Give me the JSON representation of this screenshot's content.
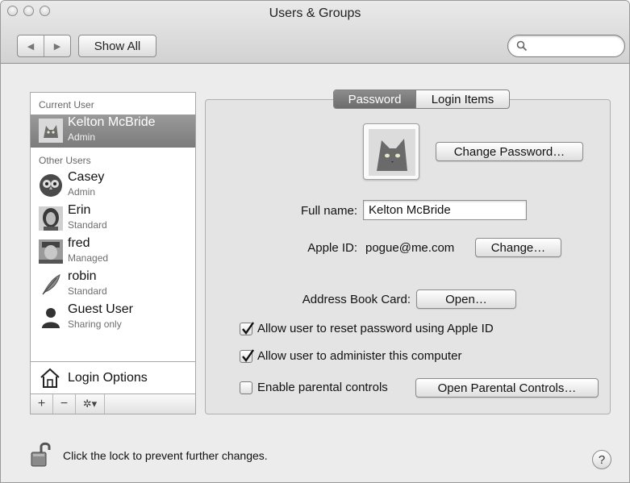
{
  "window": {
    "title": "Users & Groups"
  },
  "toolbar": {
    "back_icon": "◀",
    "forward_icon": "▶",
    "show_all_label": "Show All",
    "search_placeholder": ""
  },
  "sidebar": {
    "current_user_header": "Current User",
    "current_user": {
      "name": "Kelton McBride",
      "role": "Admin",
      "avatar": "cat-avatar"
    },
    "other_users_header": "Other Users",
    "other_users": [
      {
        "name": "Casey",
        "role": "Admin",
        "avatar": "owl-avatar"
      },
      {
        "name": "Erin",
        "role": "Standard",
        "avatar": "woman-avatar"
      },
      {
        "name": "fred",
        "role": "Managed",
        "avatar": "man-avatar"
      },
      {
        "name": "robin",
        "role": "Standard",
        "avatar": "feather-avatar"
      },
      {
        "name": "Guest User",
        "role": "Sharing only",
        "avatar": "silhouette-avatar"
      }
    ],
    "login_options_label": "Login Options",
    "add_label": "+",
    "remove_label": "−",
    "action_label": "✲▾"
  },
  "tabs": [
    {
      "label": "Password",
      "active": true
    },
    {
      "label": "Login Items",
      "active": false
    }
  ],
  "password_pane": {
    "change_password_label": "Change Password…",
    "full_name_label": "Full name:",
    "full_name_value": "Kelton McBride",
    "apple_id_label": "Apple ID:",
    "apple_id_value": "pogue@me.com",
    "change_label": "Change…",
    "address_book_label": "Address Book Card:",
    "open_label": "Open…",
    "allow_reset_label": "Allow user to reset password using Apple ID",
    "allow_reset_checked": true,
    "allow_admin_label": "Allow user to administer this computer",
    "allow_admin_checked": true,
    "parental_label": "Enable parental controls",
    "parental_checked": false,
    "open_parental_label": "Open Parental Controls…"
  },
  "footer": {
    "lock_text": "Click the lock to prevent further changes.",
    "help_label": "?"
  }
}
